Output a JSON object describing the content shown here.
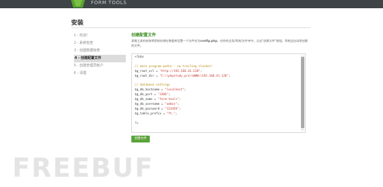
{
  "header": {
    "logo_text": "FORM TOOLS"
  },
  "page": {
    "title": "安装"
  },
  "steps": [
    {
      "label": "1 - 欢迎!"
    },
    {
      "label": "2 - 系统检查"
    },
    {
      "label": "3 - 创建数据库表"
    },
    {
      "label": "4 - 创建配置文件"
    },
    {
      "label": "5 - 创建管理员帐户"
    },
    {
      "label": "6 - 清理"
    }
  ],
  "section": {
    "title": "创建配置文件",
    "description_1": "表格工具的安装将即刻存储在数据库设置一个文件名为",
    "description_file": "config.php",
    "description_2": "。在你的全局/系统/文件夹中。点击\"创建文件\"按钮。系统会自动把创建的文件。"
  },
  "code": {
    "open_tag": "<?php",
    "comment_paths": "// main program paths - no trailing slashes!",
    "root_url_var": "$g_root_url = ",
    "root_url_val": "\"http://192.168.41.128\"",
    "root_dir_var": "$g_root_dir = ",
    "root_dir_val": "\"C:\\\\phpstudy_pro\\\\WWW\\\\192.168.41.128\"",
    "comment_db": "// database settings",
    "db_hostname_var": "$g_db_hostname = ",
    "db_hostname_val": "\"localhost\"",
    "db_port_var": "$g_db_port = ",
    "db_port_val": "\"3306\"",
    "db_name_var": "$g_db_name = ",
    "db_name_val": "\"form-tools\"",
    "db_username_var": "$g_db_username = ",
    "db_username_val": "\"admin\"",
    "db_password_var": "$g_db_password = ",
    "db_password_val": "\"123456\"",
    "table_prefix_var": "$g_table_prefix = ",
    "table_prefix_val": "\"ft_\"",
    "close_tag": "?>"
  },
  "button": {
    "create_file": "创建文件"
  },
  "watermark": "FREEBUF",
  "colors": {
    "accent_green": "#5aa33a",
    "topbar": "#3f4447",
    "comment": "#b8860b",
    "string": "#c4352b"
  }
}
